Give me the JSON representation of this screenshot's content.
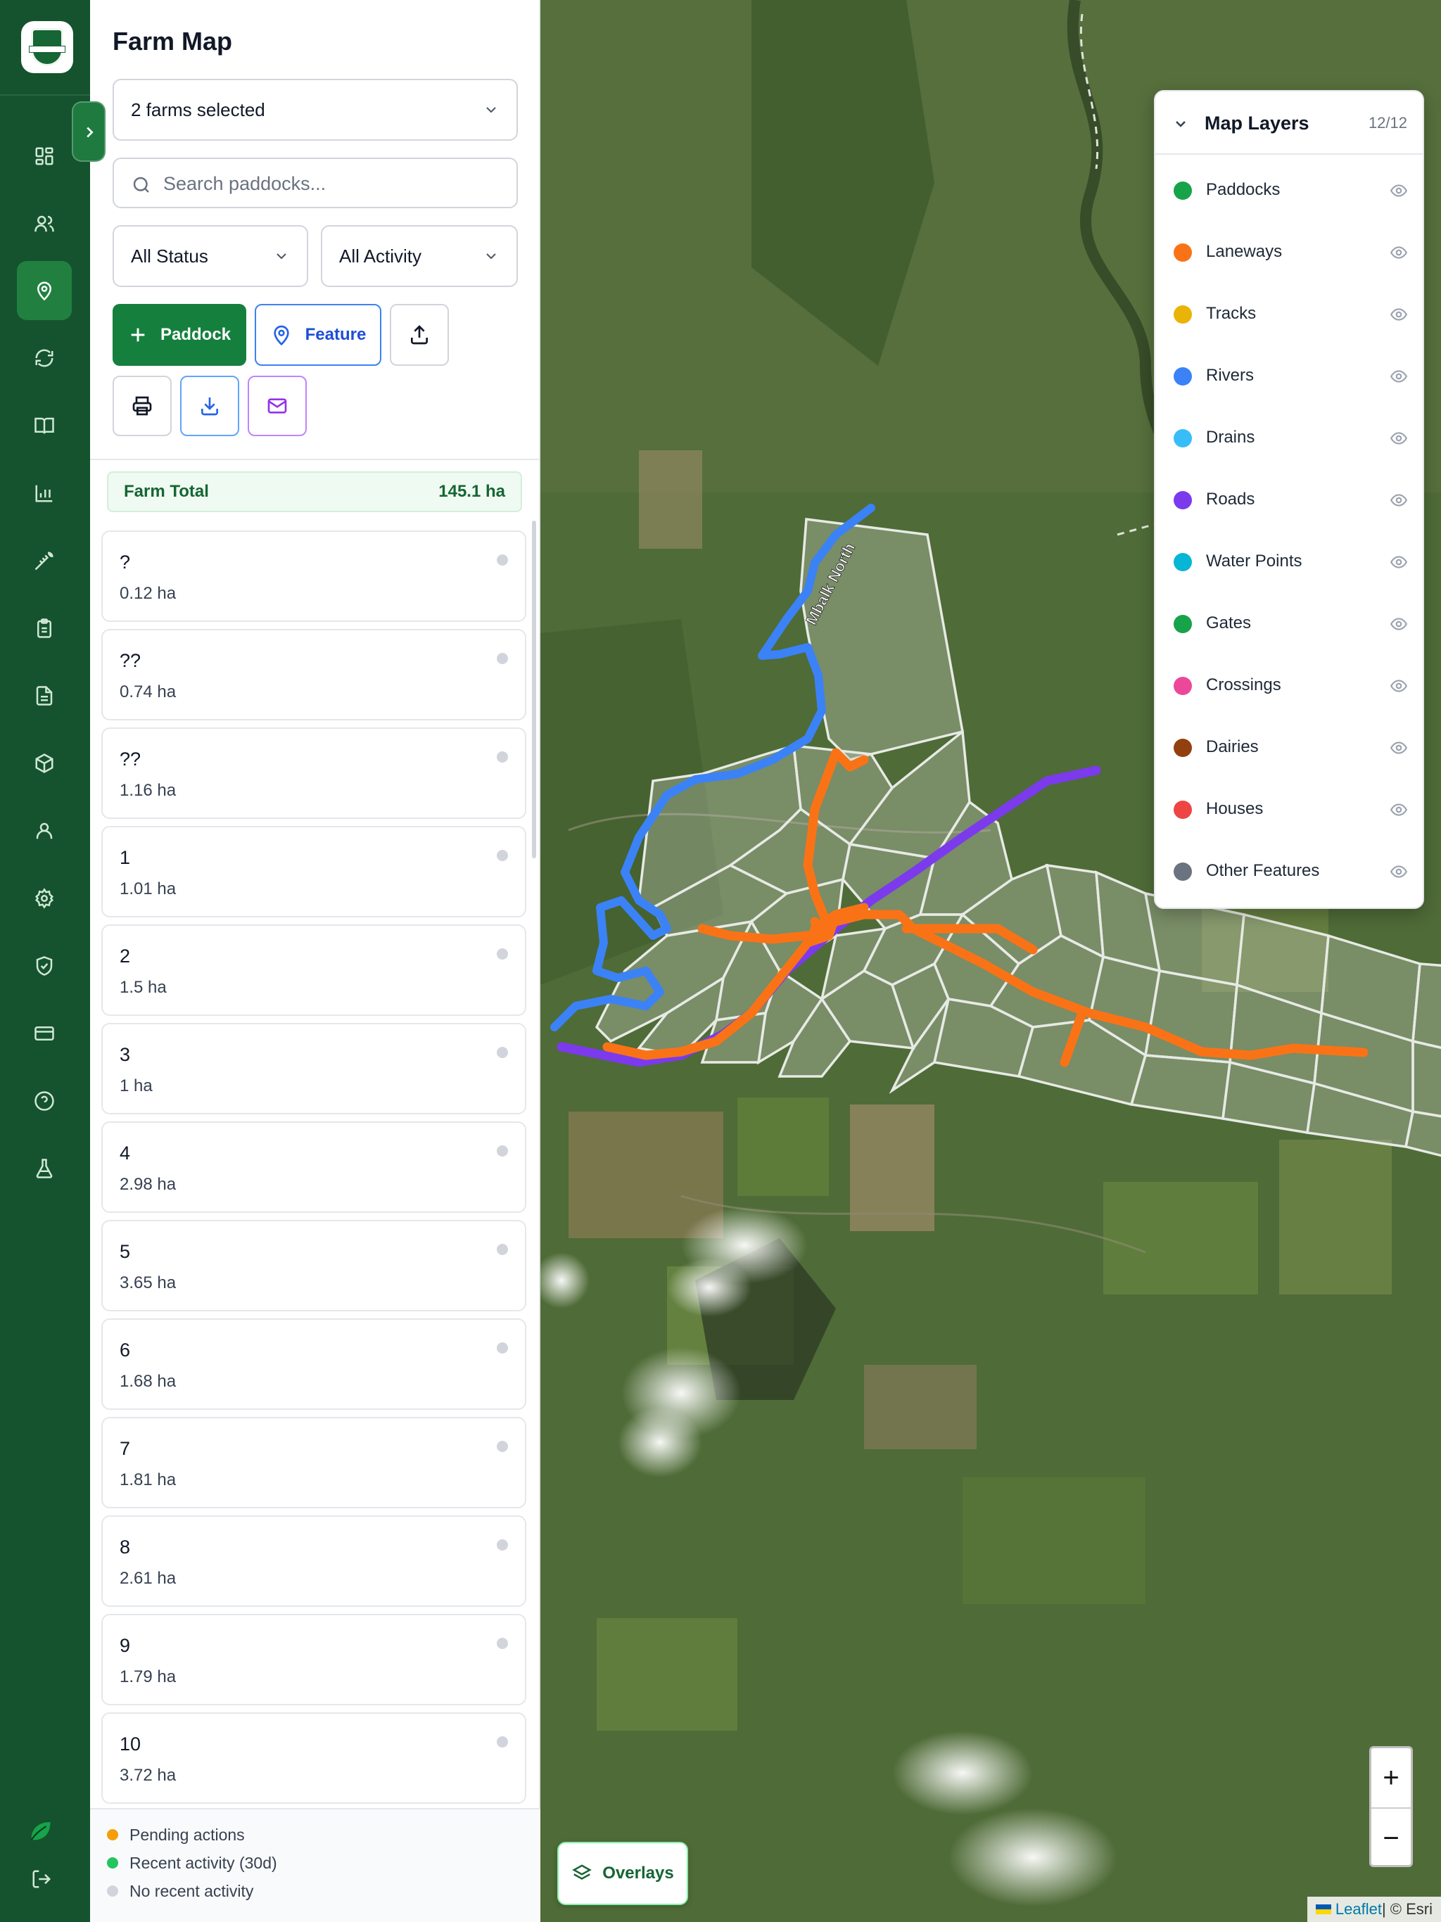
{
  "app": {
    "title": "Farm Map"
  },
  "rail": {
    "items": [
      {
        "icon": "dashboard-icon"
      },
      {
        "icon": "users-icon"
      },
      {
        "icon": "map-pin-icon",
        "active": true
      },
      {
        "icon": "refresh-icon"
      },
      {
        "icon": "book-icon"
      },
      {
        "icon": "bar-chart-icon"
      },
      {
        "icon": "wheat-icon"
      },
      {
        "icon": "clipboard-icon"
      },
      {
        "icon": "document-icon"
      },
      {
        "icon": "package-icon"
      },
      {
        "icon": "user-icon"
      },
      {
        "icon": "gear-icon"
      },
      {
        "icon": "shield-check-icon"
      },
      {
        "icon": "credit-card-icon"
      },
      {
        "icon": "help-icon"
      },
      {
        "icon": "flask-icon"
      }
    ]
  },
  "filters": {
    "farm_select": "2 farms selected",
    "search_placeholder": "Search paddocks...",
    "status": "All Status",
    "activity": "All Activity"
  },
  "actions": {
    "paddock_label": "Paddock",
    "feature_label": "Feature"
  },
  "farm_total": {
    "label": "Farm Total",
    "value": "145.1 ha"
  },
  "paddocks": [
    {
      "name": "?",
      "area": "0.12 ha"
    },
    {
      "name": "??",
      "area": "0.74 ha"
    },
    {
      "name": "??",
      "area": "1.16 ha"
    },
    {
      "name": "1",
      "area": "1.01 ha"
    },
    {
      "name": "2",
      "area": "1.5 ha"
    },
    {
      "name": "3",
      "area": "1 ha"
    },
    {
      "name": "4",
      "area": "2.98 ha"
    },
    {
      "name": "5",
      "area": "3.65 ha"
    },
    {
      "name": "6",
      "area": "1.68 ha"
    },
    {
      "name": "7",
      "area": "1.81 ha"
    },
    {
      "name": "8",
      "area": "2.61 ha"
    },
    {
      "name": "9",
      "area": "1.79 ha"
    },
    {
      "name": "10",
      "area": "3.72 ha"
    }
  ],
  "legend": [
    {
      "label": "Pending actions",
      "color": "#f59e0b"
    },
    {
      "label": "Recent activity (30d)",
      "color": "#22c55e"
    },
    {
      "label": "No recent activity",
      "color": "#d1d5db"
    }
  ],
  "map_layers": {
    "title": "Map Layers",
    "count": "12/12",
    "items": [
      {
        "name": "Paddocks",
        "color": "#16a34a"
      },
      {
        "name": "Laneways",
        "color": "#f97316"
      },
      {
        "name": "Tracks",
        "color": "#eab308"
      },
      {
        "name": "Rivers",
        "color": "#3b82f6"
      },
      {
        "name": "Drains",
        "color": "#38bdf8"
      },
      {
        "name": "Roads",
        "color": "#7c3aed"
      },
      {
        "name": "Water Points",
        "color": "#06b6d4"
      },
      {
        "name": "Gates",
        "color": "#16a34a"
      },
      {
        "name": "Crossings",
        "color": "#ec4899"
      },
      {
        "name": "Dairies",
        "color": "#92400e"
      },
      {
        "name": "Houses",
        "color": "#ef4444"
      },
      {
        "name": "Other Features",
        "color": "#6b7280"
      }
    ]
  },
  "map": {
    "road_label": "Mbalk North",
    "zoom_in": "+",
    "zoom_out": "−",
    "overlays_label": "Overlays",
    "attribution_leaflet": "Leaflet",
    "attribution_rest": " | © Esri"
  }
}
